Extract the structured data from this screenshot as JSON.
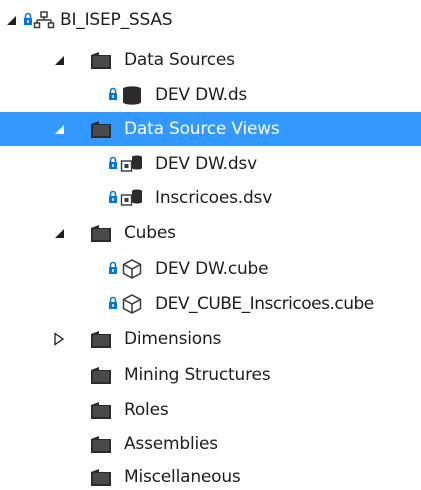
{
  "solution_explorer": {
    "root": {
      "label": "BI_ISEP_SSAS"
    },
    "data_sources": {
      "label": "Data Sources",
      "items": [
        {
          "label": "DEV DW.ds"
        }
      ]
    },
    "data_source_views": {
      "label": "Data Source Views",
      "items": [
        {
          "label": "DEV DW.dsv"
        },
        {
          "label": "Inscricoes.dsv"
        }
      ]
    },
    "cubes": {
      "label": "Cubes",
      "items": [
        {
          "label": "DEV DW.cube"
        },
        {
          "label": "DEV_CUBE_Inscricoes.cube"
        }
      ]
    },
    "dimensions": {
      "label": "Dimensions"
    },
    "mining_structures": {
      "label": "Mining Structures"
    },
    "roles": {
      "label": "Roles"
    },
    "assemblies": {
      "label": "Assemblies"
    },
    "miscellaneous": {
      "label": "Miscellaneous"
    }
  },
  "colors": {
    "selection": "#3399ff",
    "lock": "#0078d7",
    "folder": "#2b2b2b"
  },
  "icons": {
    "expanded": "expanded-triangle-icon",
    "collapsed": "collapsed-triangle-icon",
    "lock": "lock-icon",
    "project": "project-icon",
    "folder": "folder-icon",
    "data_source": "database-icon",
    "data_source_view": "data-source-view-icon",
    "cube": "cube-icon"
  }
}
